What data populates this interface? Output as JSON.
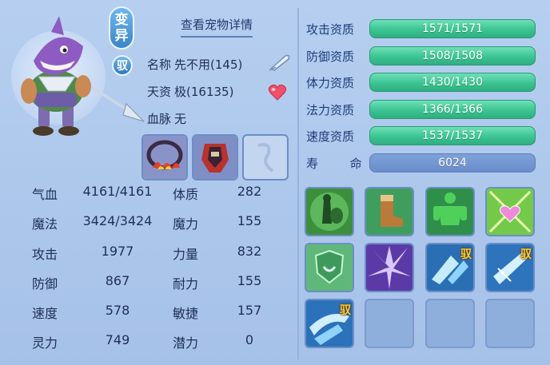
{
  "pet": {
    "badge_mutant_line1": "变",
    "badge_mutant_line2": "异",
    "badge_tame": "驭",
    "detail_link": "查看宠物详情",
    "name_label": "名称",
    "name_value": "先不用(145)",
    "talent_label": "天资",
    "talent_value": "极(16135)",
    "bloodline_label": "血脉",
    "bloodline_value": "无"
  },
  "stats": [
    {
      "label": "气血",
      "value": "4161/4161",
      "label2": "体质",
      "value2": "282"
    },
    {
      "label": "魔法",
      "value": "3424/3424",
      "label2": "魔力",
      "value2": "155"
    },
    {
      "label": "攻击",
      "value": "1977",
      "label2": "力量",
      "value2": "832"
    },
    {
      "label": "防御",
      "value": "867",
      "label2": "耐力",
      "value2": "155"
    },
    {
      "label": "速度",
      "value": "578",
      "label2": "敏捷",
      "value2": "157"
    },
    {
      "label": "灵力",
      "value": "749",
      "label2": "潜力",
      "value2": "0"
    }
  ],
  "aptitudes": [
    {
      "label": "攻击资质",
      "value": "1571/1571",
      "fill": 1.0
    },
    {
      "label": "防御资质",
      "value": "1508/1508",
      "fill": 1.0
    },
    {
      "label": "体力资质",
      "value": "1430/1430",
      "fill": 1.0
    },
    {
      "label": "法力资质",
      "value": "1366/1366",
      "fill": 1.0
    },
    {
      "label": "速度资质",
      "value": "1537/1537",
      "fill": 1.0
    }
  ],
  "life": {
    "label_a": "寿",
    "label_b": "命",
    "value": "6024"
  },
  "skills": {
    "tag": "驭"
  },
  "colors": {
    "bar_green": "#3cc492",
    "bar_life": "#6a8dcb",
    "panel": "#a9c4ea"
  },
  "icons": {
    "edit": "quill-edit-icon",
    "heart": "heart-icon"
  }
}
